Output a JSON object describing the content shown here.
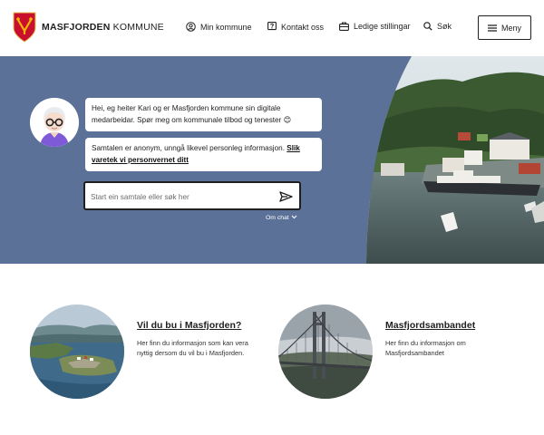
{
  "header": {
    "logo_bold": "MASFJORDEN",
    "logo_rest": " KOMMUNE",
    "nav": {
      "min_kommune": "Min kommune",
      "kontakt_oss": "Kontakt oss",
      "ledige_stillingar": "Ledige stillingar",
      "sok": "Søk"
    },
    "menu_label": "Meny"
  },
  "chat": {
    "greeting": "Hei, eg heiter Kari og er Masfjorden kommune sin digitale medarbeidar. Spør meg om kommunale tilbod og tenester 😊",
    "privacy_text": "Samtalen er anonym, unngå likevel personleg informasjon. ",
    "privacy_link": "Slik varetek vi personvernet ditt",
    "input_placeholder": "Start ein samtale eller søk her",
    "om_chat": "Om chat"
  },
  "cards": [
    {
      "title": "Vil du bu i Masfjorden?",
      "description": "Her finn du informasjon som kan vera nyttig dersom du vil bu i Masfjorden."
    },
    {
      "title": "Masfjordsambandet",
      "description": "Her finn du informasjon om Masfjordsambandet"
    }
  ],
  "colors": {
    "hero_bg": "#5b7197",
    "coat_of_arms_red": "#c8102e",
    "coat_of_arms_gold": "#f2b705"
  },
  "icons": [
    "coat-of-arms-icon",
    "user-circle-icon",
    "chat-question-icon",
    "briefcase-icon",
    "search-icon",
    "hamburger-icon",
    "send-icon",
    "chevron-down-icon"
  ]
}
